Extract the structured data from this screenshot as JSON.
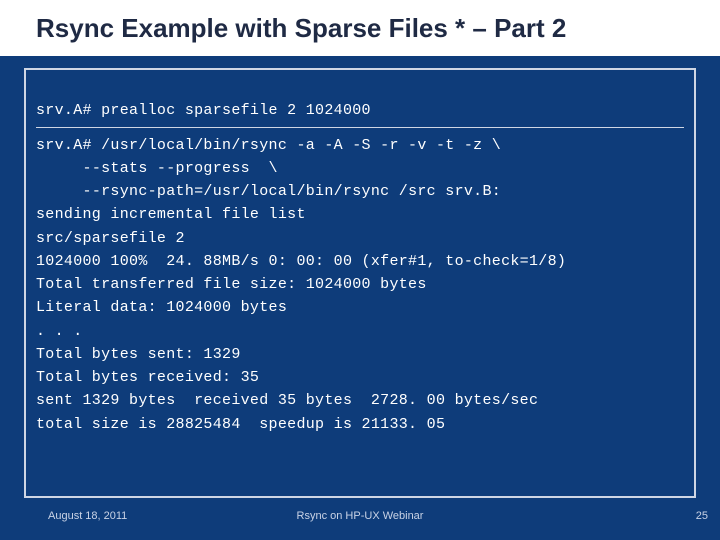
{
  "slide": {
    "title": "Rsync Example with Sparse Files * – Part 2"
  },
  "terminal": {
    "cmd1_prompt": "srv.A#",
    "cmd1_rest": " prealloc sparsefile 2 1024000",
    "cmd2_line1": "srv.A# /usr/local/bin/rsync -a -A -S -r -v -t -z \\",
    "cmd2_line2": "     --stats --progress  \\",
    "cmd2_line3": "     --rsync-path=/usr/local/bin/rsync /src srv.B:",
    "out_sending": "sending incremental file list",
    "out_file": "src/sparsefile 2",
    "out_progress": "1024000 100%  24. 88MB/s 0: 00: 00 (xfer#1, to-check=1/8)",
    "out_total_transferred": "Total transferred file size: 1024000 bytes",
    "out_literal": "Literal data: 1024000 bytes",
    "out_ellipsis": ". . .",
    "out_bytes_sent": "Total bytes sent: 1329",
    "out_bytes_recv": "Total bytes received: 35",
    "out_summary1": "sent 1329 bytes  received 35 bytes  2728. 00 bytes/sec",
    "out_summary2": "total size is 28825484  speedup is 21133. 05"
  },
  "footer": {
    "date": "August 18, 2011",
    "title": "Rsync on HP-UX Webinar",
    "page": "25"
  }
}
